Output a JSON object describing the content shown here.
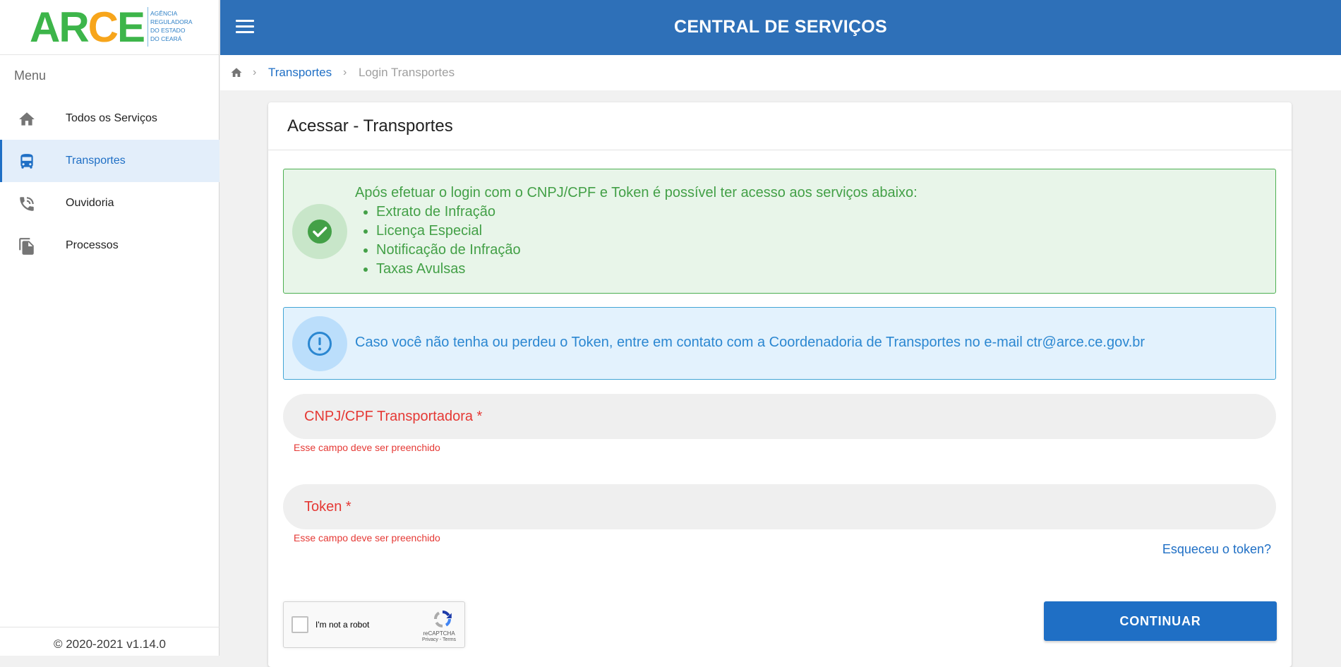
{
  "logo": {
    "text_a": "AR",
    "text_c": "C",
    "text_e": "E",
    "subtitle_lines": [
      "AGÊNCIA",
      "REGULADORA",
      "DO ESTADO",
      "DO CEARÁ"
    ]
  },
  "sidebar": {
    "menu_label": "Menu",
    "items": [
      {
        "label": "Todos os Serviços",
        "icon": "home-icon",
        "active": false
      },
      {
        "label": "Transportes",
        "icon": "bus-icon",
        "active": true
      },
      {
        "label": "Ouvidoria",
        "icon": "phone-icon",
        "active": false
      },
      {
        "label": "Processos",
        "icon": "files-icon",
        "active": false
      }
    ],
    "footer": "© 2020-2021 v1.14.0"
  },
  "header": {
    "title": "CENTRAL DE SERVIÇOS"
  },
  "breadcrumb": {
    "link": "Transportes",
    "current": "Login Transportes",
    "separator": "›"
  },
  "card": {
    "title": "Acessar - Transportes",
    "success_alert": {
      "text": "Após efetuar o login com o CNPJ/CPF e Token é possível ter acesso aos serviços abaixo:",
      "items": [
        "Extrato de Infração",
        "Licença Especial",
        "Notificação de Infração",
        "Taxas Avulsas"
      ]
    },
    "info_alert": {
      "text": "Caso você não tenha ou perdeu o Token, entre em contato com a Coordenadoria de Transportes no e-mail ctr@arce.ce.gov.br"
    },
    "cnpj_field": {
      "label": "CNPJ/CPF Transportadora *",
      "value": "",
      "error": "Esse campo deve ser preenchido"
    },
    "token_field": {
      "label": "Token *",
      "value": "",
      "error": "Esse campo deve ser preenchido"
    },
    "forgot_link": "Esqueceu o token?",
    "recaptcha": {
      "label": "I'm not a robot",
      "brand": "reCAPTCHA",
      "terms": "Privacy - Terms"
    },
    "continue_button": "CONTINUAR"
  },
  "colors": {
    "header_bg": "#2e70b8",
    "accent": "#1f6fc5",
    "success": "#43a047",
    "info": "#2b87d1",
    "error": "#e53935"
  }
}
